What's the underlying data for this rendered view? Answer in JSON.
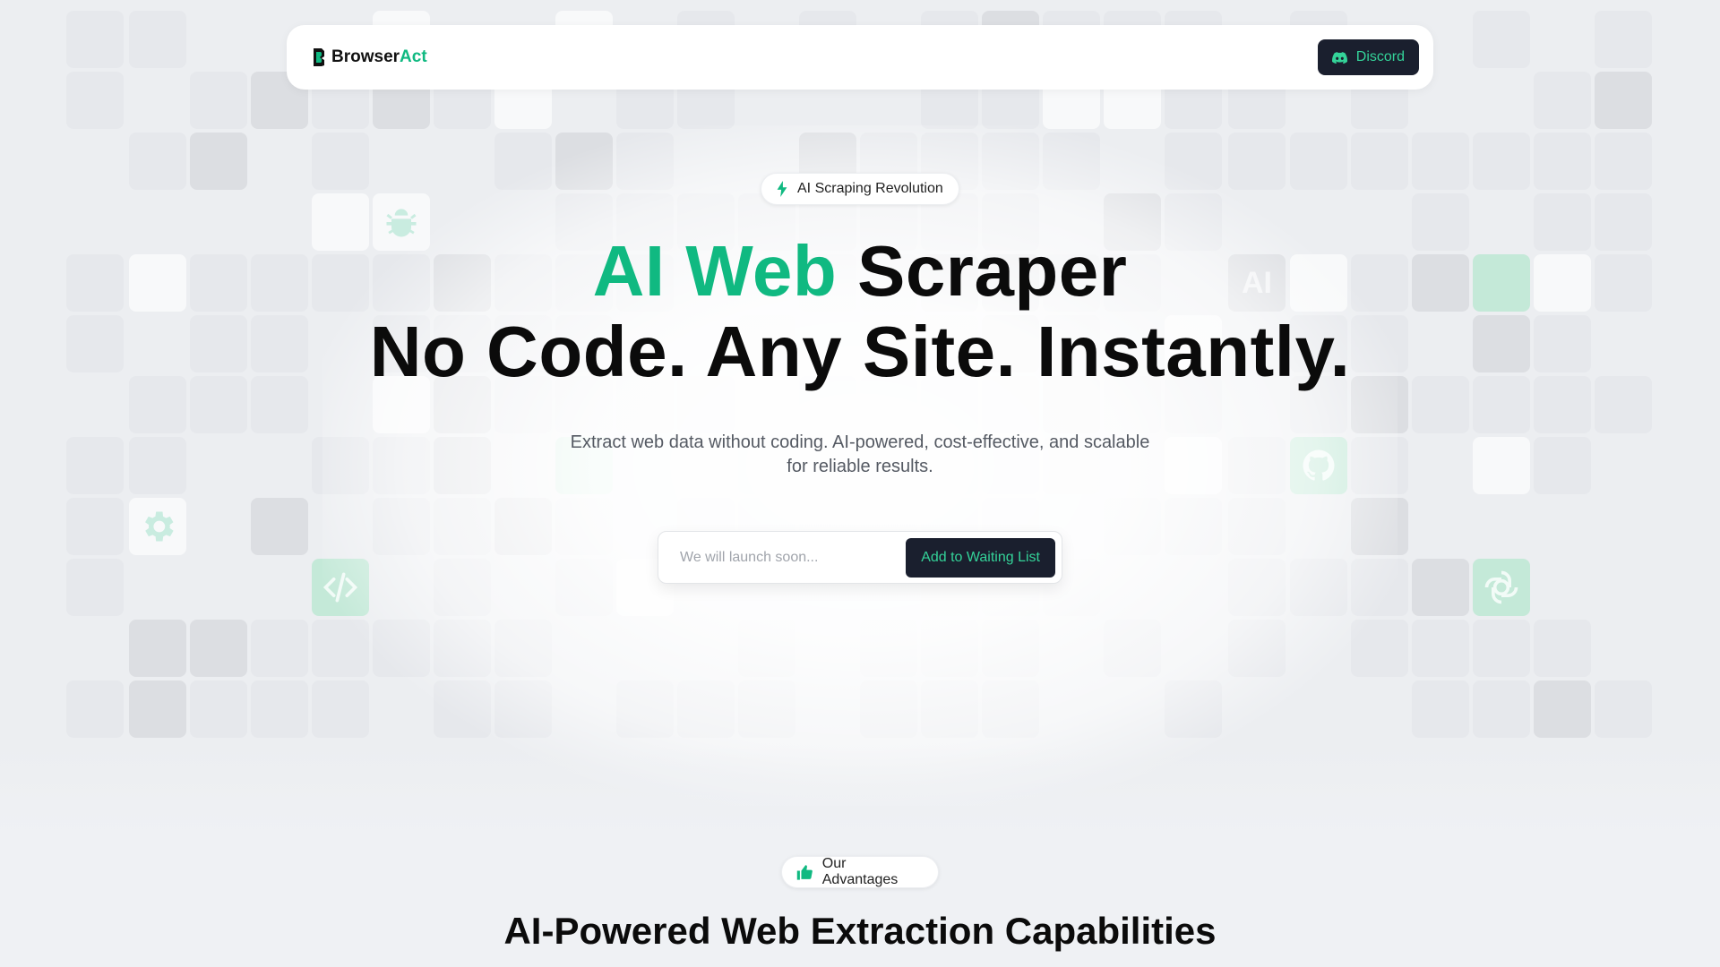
{
  "colors": {
    "accent": "#10b981",
    "button_bg": "#1a1f2e",
    "button_text": "#34d399"
  },
  "header": {
    "brand_prefix": "Browser",
    "brand_accent": "Act",
    "brand_icon": "browseract-logo-icon",
    "discord_label": "Discord",
    "discord_icon": "discord-icon"
  },
  "hero": {
    "badge_label": "AI Scraping Revolution",
    "badge_icon": "lightning-icon",
    "title_green": "AI Web",
    "title_dark": "Scraper",
    "title_line2": "No Code. Any Site. Instantly.",
    "subtitle": "Extract web data without coding. AI-powered, cost-effective, and scalable for reliable results.",
    "signup_placeholder": "We will launch soon...",
    "signup_button": "Add to Waiting List"
  },
  "background_icons": [
    "bug-icon",
    "ai-text-icon",
    "github-icon",
    "gear-icon",
    "code-icon",
    "openai-icon"
  ],
  "background_ai_text": "AI",
  "advantages": {
    "badge_label": "Our Advantages",
    "badge_icon": "thumbs-up-icon",
    "title": "AI-Powered Web Extraction Capabilities"
  }
}
